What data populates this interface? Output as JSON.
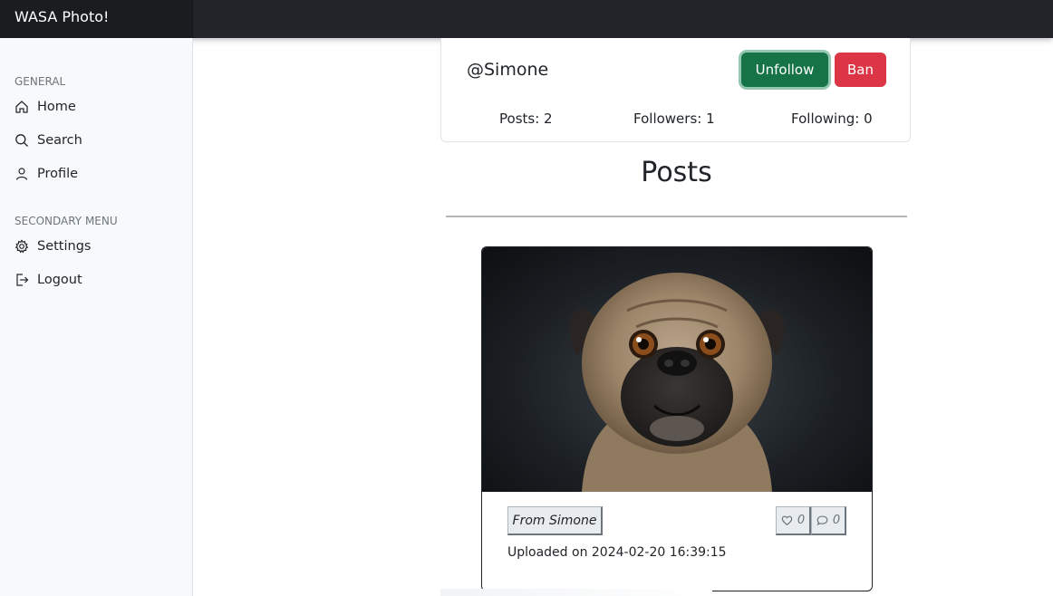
{
  "app": {
    "title": "WASA Photo!"
  },
  "sidebar": {
    "general_heading": "GENERAL",
    "general_items": [
      {
        "label": "Home",
        "icon": "home-icon"
      },
      {
        "label": "Search",
        "icon": "search-icon"
      },
      {
        "label": "Profile",
        "icon": "user-icon"
      }
    ],
    "secondary_heading": "SECONDARY MENU",
    "secondary_items": [
      {
        "label": "Settings",
        "icon": "gear-icon"
      },
      {
        "label": "Logout",
        "icon": "logout-icon"
      }
    ]
  },
  "profile": {
    "username": "@Simone",
    "unfollow_label": "Unfollow",
    "ban_label": "Ban",
    "posts_stat": "Posts: 2",
    "followers_stat": "Followers: 1",
    "following_stat": "Following: 0"
  },
  "posts_section": {
    "heading": "Posts"
  },
  "posts": [
    {
      "author_label": "From Simone",
      "likes": "0",
      "comments": "0",
      "uploaded": "Uploaded on 2024-02-20 16:39:15"
    }
  ],
  "colors": {
    "navbar": "#212529",
    "unfollow": "#157347",
    "ban": "#dc3545",
    "sidebar_bg": "#f8f9fa"
  }
}
